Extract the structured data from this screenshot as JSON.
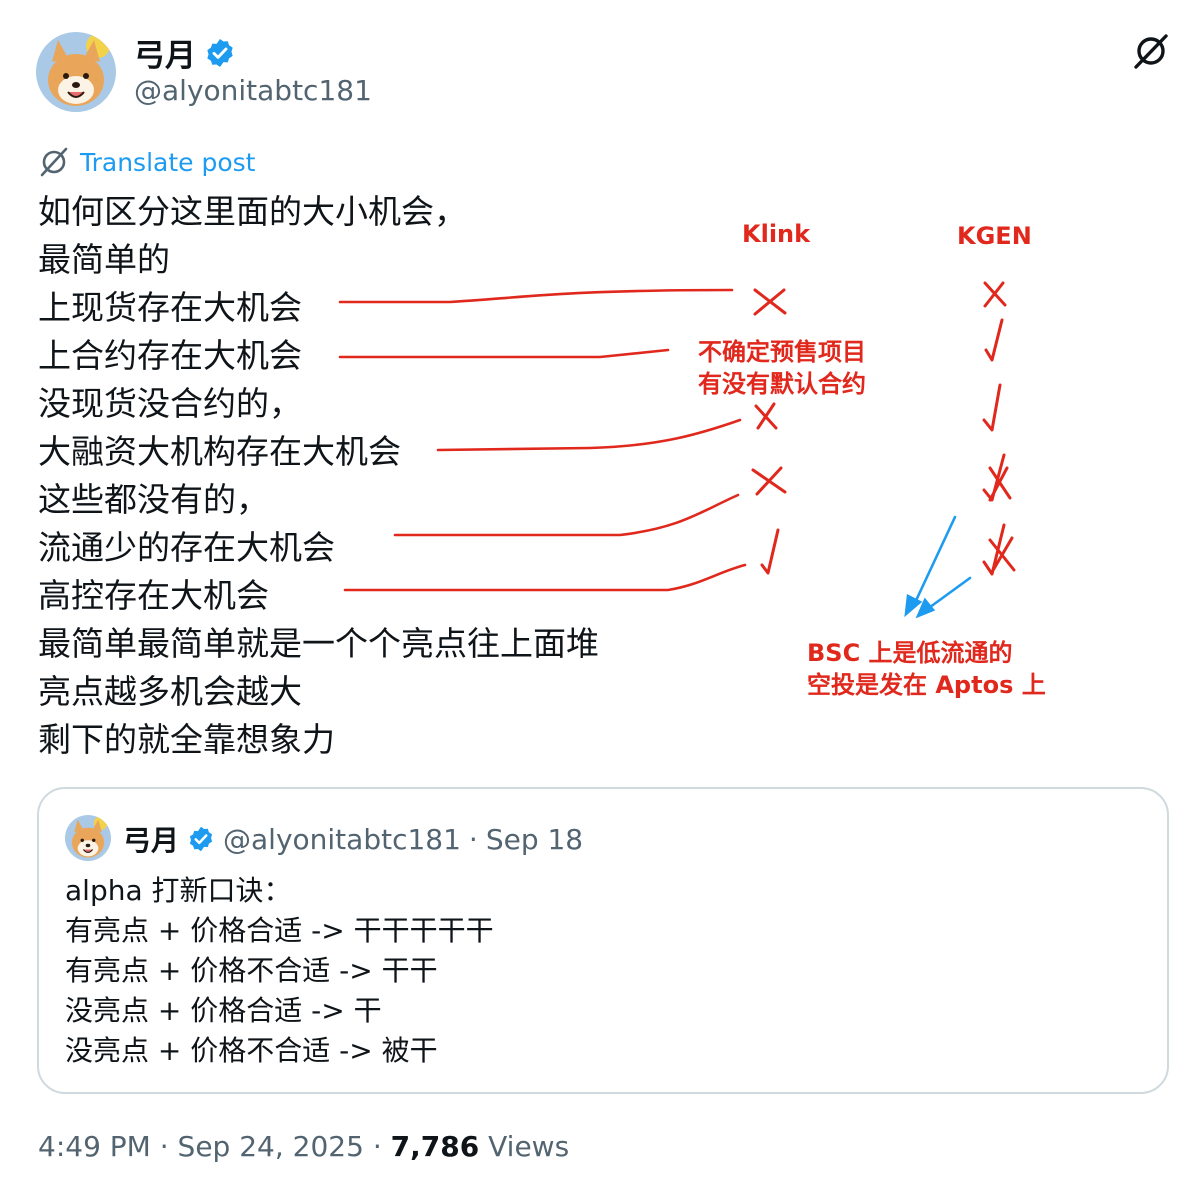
{
  "author": {
    "name": "弓月",
    "handle": "@alyonitabtc181",
    "verified": true,
    "avatar_icon": "shiba-avatar-icon"
  },
  "actions": {
    "grok_icon": "grok-icon"
  },
  "translate_label": "Translate post",
  "body_lines": [
    "如何区分这里面的大小机会，",
    "最简单的",
    "上现货存在大机会",
    "上合约存在大机会",
    "没现货没合约的，",
    "大融资大机构存在大机会",
    "这些都没有的，",
    "流通少的存在大机会",
    "高控存在大机会",
    "最简单最简单就是一个个亮点往上面堆",
    "亮点越多机会越大",
    "剩下的就全靠想象力"
  ],
  "annotations": {
    "col1": "Klink",
    "col2": "KGEN",
    "note1_line1": "不确定预售项目",
    "note1_line2": "有没有默认合约",
    "note2_line1": "BSC 上是低流通的",
    "note2_line2": "空投是发在 Aptos 上",
    "marks_klink": [
      "✗",
      "",
      "✗",
      "✗",
      "✓"
    ],
    "marks_kgen": [
      "✗",
      "✓",
      "✓",
      "✓✗",
      "✓✗"
    ],
    "color": "#e0281d",
    "arrow_color": "#1d9bf0"
  },
  "quote": {
    "name": "弓月",
    "handle": "@alyonitabtc181",
    "date": "Sep 18",
    "lines": [
      "alpha 打新口诀：",
      "有亮点 + 价格合适 -> 干干干干干",
      "有亮点 + 价格不合适 -> 干干",
      "没亮点 + 价格合适 -> 干",
      "没亮点 + 价格不合适 -> 被干"
    ]
  },
  "footer": {
    "time": "4:49 PM",
    "date": "Sep 24, 2025",
    "views_count": "7,786",
    "views_label": "Views"
  },
  "colors": {
    "link": "#1d9bf0",
    "secondary": "#536471",
    "border": "#cfd9de"
  }
}
